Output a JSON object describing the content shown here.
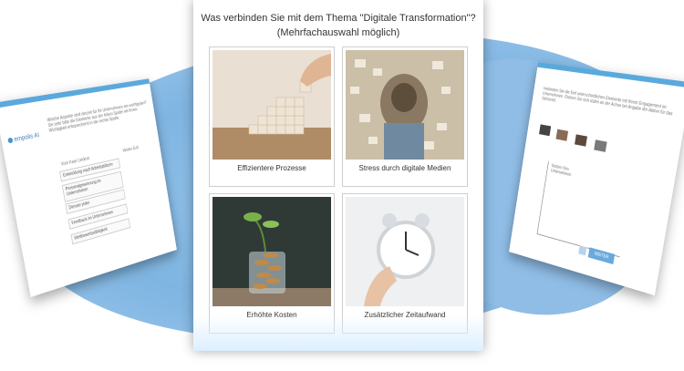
{
  "background": {
    "accent": "#7fb5e2"
  },
  "left_slide": {
    "logo_text": "empolis AI",
    "intro_text": "Welche Aspekte sind derzeit für Ihr Unternehmen am wichtigsten? Sie sehr bitte die Elemente aus der linken Spalte mit Ihrem Wichtigkeit entsprechend in die rechte Spalte.",
    "left_header": "Vom Kaar Liedent",
    "right_header": "Weiter Exit",
    "items": [
      "Entwicklung nach Arbeitsplätzen",
      "Personalgewinnung im Unternehmen",
      "Dienste jeder",
      "Feedback im Unternehmen",
      "Wettbewerbsfähigkeit"
    ]
  },
  "center": {
    "question": "Was verbinden Sie mit dem Thema \"Digitale Transformation\"?",
    "hint": "(Mehrfachauswahl möglich)",
    "options": [
      {
        "label": "Effizientere Prozesse"
      },
      {
        "label": "Stress durch digitale Medien"
      },
      {
        "label": "Erhöhte Kosten"
      },
      {
        "label": "Zusätzlicher Zeitaufwand"
      }
    ]
  },
  "right_slide": {
    "intro_text": "Verbinden Sie die fünf unterschiedlichen Elemente mit Ihrem Engagement im Unternehmen. Ordnen Sie sich dabei an der Achse bei Angabe der Aktive für das Stichwort.",
    "axis_label": "Nutzen fürs Unternehmen",
    "weiter_label": "WEITER"
  }
}
